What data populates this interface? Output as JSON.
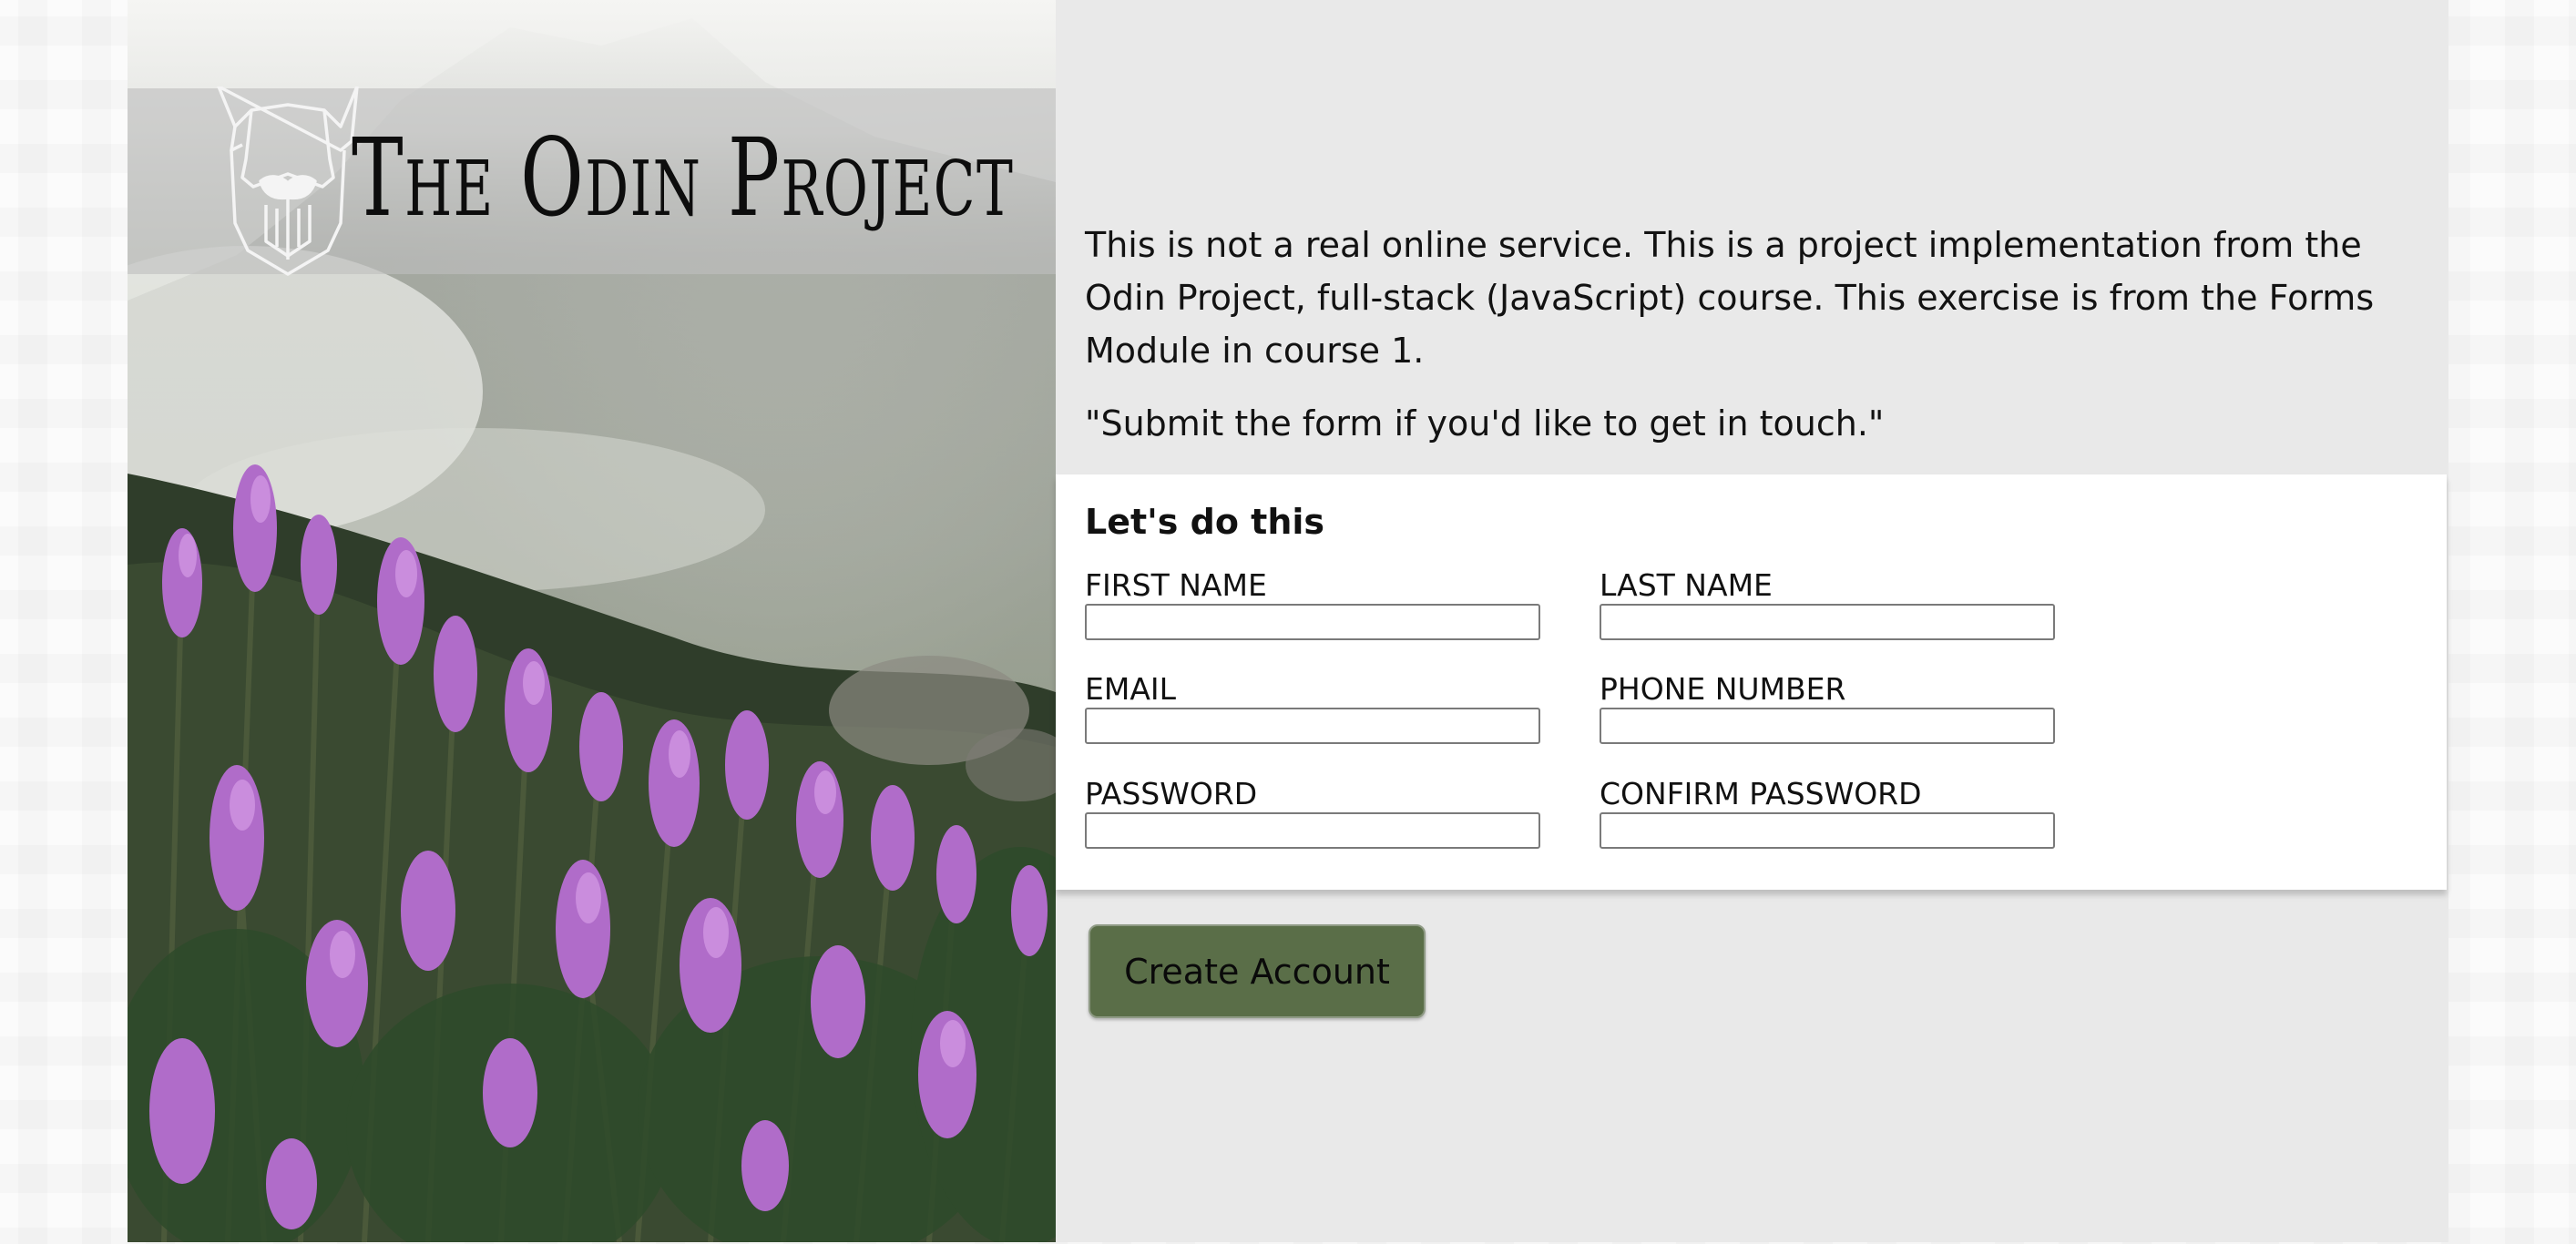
{
  "header": {
    "brand_title": "The Odin Project",
    "logo_icon": "odin-viking-logo"
  },
  "intro": {
    "paragraph": "This is not a real online service. This is a project implementation from the Odin Project, full-stack (JavaScript) course. This exercise is from the Forms Module in course 1.",
    "quote": "\"Submit the form if you'd like to get in touch.\""
  },
  "form": {
    "title": "Let's do this",
    "fields": {
      "first_name": {
        "label": "FIRST NAME",
        "value": ""
      },
      "last_name": {
        "label": "LAST NAME",
        "value": ""
      },
      "email": {
        "label": "EMAIL",
        "value": ""
      },
      "phone": {
        "label": "PHONE NUMBER",
        "value": ""
      },
      "password": {
        "label": "PASSWORD",
        "value": ""
      },
      "confirm_password": {
        "label": "CONFIRM PASSWORD",
        "value": ""
      }
    },
    "submit_label": "Create Account"
  },
  "colors": {
    "button_bg": "#5a6e48",
    "panel_bg": "#e9e9e9",
    "card_bg": "#ffffff",
    "flower": "#b36ad0"
  }
}
